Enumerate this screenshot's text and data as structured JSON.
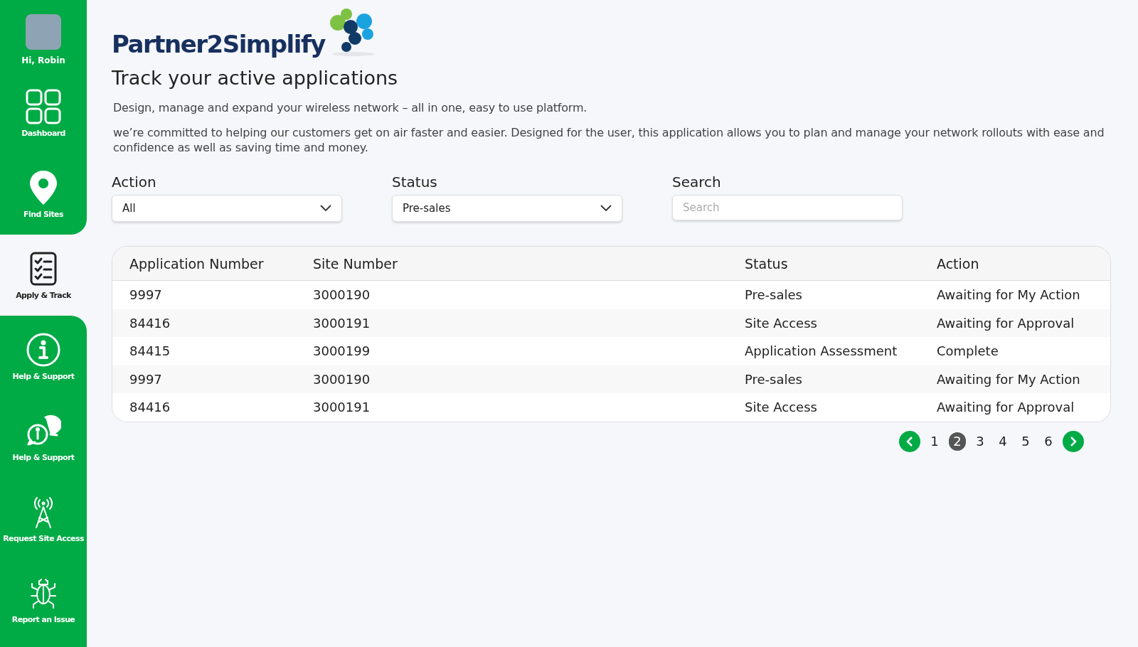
{
  "sidebar": {
    "user": {
      "greeting": "Hi, Robin"
    },
    "items": [
      {
        "label": "Dashboard",
        "kind": "dashboard",
        "selected": false
      },
      {
        "label": "Find Sites",
        "kind": "pin",
        "selected": false
      },
      {
        "label": "Apply & Track",
        "kind": "checklist",
        "selected": true
      },
      {
        "label": "Help & Support",
        "kind": "info",
        "selected": false
      },
      {
        "label": "Help & Support",
        "kind": "chat",
        "selected": false
      },
      {
        "label": "Request Site Access",
        "kind": "tower",
        "selected": false
      },
      {
        "label": "Report an Issue",
        "kind": "bug",
        "selected": false
      }
    ]
  },
  "logo": {
    "text": "Partner2Simplify"
  },
  "title": "Track your active applications",
  "intro": "Design, manage and expand your wireless network – all in one, easy to use platform.",
  "description": "we’re committed to helping our customers get on air faster and easier. Designed for the user, this application allows you to plan and manage  your network rollouts with ease and confidence as well as saving time and money.",
  "filters": [
    {
      "label": "Action",
      "kind": "select",
      "value": "All"
    },
    {
      "label": "Status",
      "kind": "select",
      "value": "Pre-sales"
    },
    {
      "label": "Search",
      "kind": "search",
      "placeholder": "Search"
    }
  ],
  "table": {
    "columns": [
      "Application Number",
      "Site Number",
      "Status",
      "Action"
    ],
    "rows": [
      [
        "9997",
        "3000190",
        "Pre-sales",
        "Awaiting for My Action"
      ],
      [
        "84416",
        "3000191",
        "Site Access",
        "Awaiting for Approval"
      ],
      [
        "84415",
        "3000199",
        "Application Assessment",
        "Complete"
      ],
      [
        "9997",
        "3000190",
        "Pre-sales",
        "Awaiting for My Action"
      ],
      [
        "84416",
        "3000191",
        "Site Access",
        "Awaiting for Approval"
      ]
    ]
  },
  "pagination": {
    "pages": [
      {
        "label": "1",
        "selected": false
      },
      {
        "label": "2",
        "selected": true
      },
      {
        "label": "3",
        "selected": false
      },
      {
        "label": "4",
        "selected": false
      },
      {
        "label": "5",
        "selected": false
      },
      {
        "label": "6",
        "selected": false
      }
    ]
  }
}
